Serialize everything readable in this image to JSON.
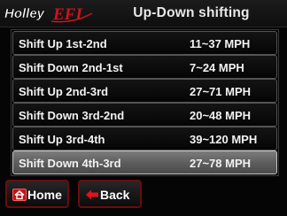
{
  "header": {
    "brand": "Holley EFI",
    "title": "Up-Down shifting"
  },
  "shift_list": {
    "rows": [
      {
        "name": "Shift Up 1st-2nd",
        "range": "11~37 MPH"
      },
      {
        "name": "Shift Down 2nd-1st",
        "range": "7~24 MPH"
      },
      {
        "name": "Shift Up 2nd-3rd",
        "range": "27~71 MPH"
      },
      {
        "name": "Shift Down 3rd-2nd",
        "range": "20~48 MPH"
      },
      {
        "name": "Shift Up 3rd-4th",
        "range": "39~120 MPH"
      },
      {
        "name": "Shift Down 4th-3rd",
        "range": "27~78 MPH"
      }
    ],
    "selected_index": 5
  },
  "buttons": {
    "home": {
      "label": "Home",
      "icon": "home-icon"
    },
    "back": {
      "label": "Back",
      "icon": "arrow-left-icon"
    }
  },
  "colors": {
    "accent": "#c8101a",
    "button_border": "#6a0c10",
    "selected_row": "#5c5c5c"
  }
}
